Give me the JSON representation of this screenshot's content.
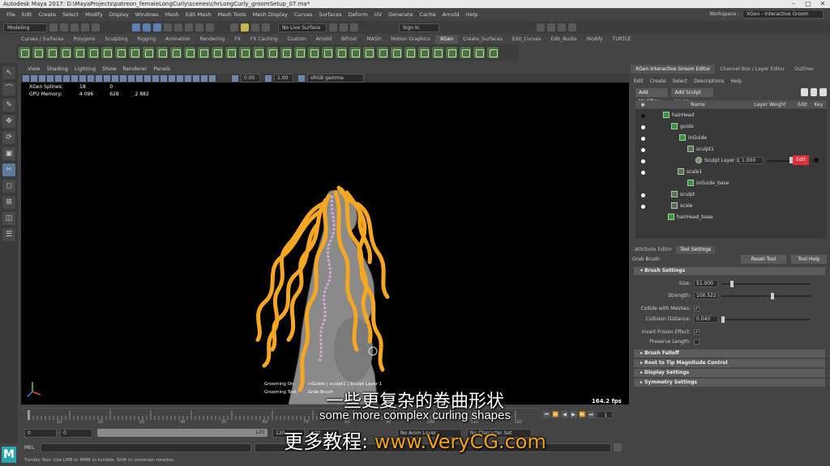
{
  "window": {
    "title": "Autodesk Maya 2017: D:\\MayaProjects\\patreon_femaleLongCurly\\scenes\\chrLongCurly_groomSetup_07.ma*",
    "controls": [
      "–",
      "□",
      "✕"
    ]
  },
  "menubar": {
    "items": [
      "File",
      "Edit",
      "Create",
      "Select",
      "Modify",
      "Display",
      "Windows",
      "Mesh",
      "Edit Mesh",
      "Mesh Tools",
      "Mesh Display",
      "Curves",
      "Surfaces",
      "Deform",
      "UV",
      "Generate",
      "Cache",
      "Arnold",
      "Help"
    ],
    "workspace_label": "Workspace :",
    "workspace_value": "XGen - Interactive Groom"
  },
  "statusline": {
    "mode": "Modeling",
    "live_surface": "No Live Surface",
    "sign_in": "Sign In"
  },
  "shelf": {
    "tabs": [
      "Curves / Surfaces",
      "Polygons",
      "Sculpting",
      "Rigging",
      "Animation",
      "Rendering",
      "FX",
      "FX Caching",
      "Custom",
      "Arnold",
      "Bifrost",
      "MASH",
      "Motion Graphics",
      "XGen",
      "Create_Surfaces",
      "Edit_Curves",
      "Edit_Nurbs",
      "Modify",
      "TURTLE"
    ],
    "active_tab": "XGen"
  },
  "viewport": {
    "menu": [
      "View",
      "Shading",
      "Lighting",
      "Show",
      "Renderer",
      "Panels"
    ],
    "exposure": "0.00",
    "gamma": "1.00",
    "color_space": "sRGB gamma",
    "hud": {
      "rows": [
        {
          "label": "XGen Splines:",
          "a": "18",
          "b": "0",
          "c": ""
        },
        {
          "label": "GPU Memory:",
          "a": "4 096",
          "b": "628",
          "c": "2 882"
        }
      ]
    },
    "groom_hud": {
      "on_label": "Grooming On:",
      "on_value": "inGuide | sculpt1 | Sculpt Layer 1",
      "tool_label": "Grooming Tool:",
      "tool_value": "Grab Brush"
    },
    "fps": "164.2 fps",
    "axis": {
      "y": "Y",
      "x": "X",
      "z": "Z"
    }
  },
  "timeline": {
    "numbers": [
      "10",
      "20",
      "30",
      "40",
      "50",
      "60",
      "70",
      "80",
      "90",
      "100",
      "110",
      "120"
    ],
    "current_frame": "1",
    "playback": [
      "⏮",
      "⏪",
      "◀",
      "▶",
      "⏩",
      "⏭"
    ]
  },
  "rangebar": {
    "start": "0",
    "playback_start": "0",
    "range_value": "120",
    "playback_end": "120",
    "end": "200",
    "anim_layer": "No Anim Layer",
    "char_set": "No Character Set"
  },
  "mel": {
    "label": "MEL"
  },
  "helpline": "Tumble Tool: Use LMB or MMB to tumble. Shift to constrain rotation.",
  "right_panel": {
    "tabs": [
      "XGen Interactive Groom Editor",
      "Channel Box / Layer Editor",
      "Outliner"
    ],
    "menu": [
      "Edit",
      "Create",
      "Select",
      "Descriptions",
      "Help"
    ],
    "add_modifier": "Add Modifier",
    "add_sculpt_layer": "Add Sculpt Layer",
    "columns": {
      "name": "Name",
      "layer_weight": "Layer Weight",
      "edit": "Edit",
      "key": "Key"
    },
    "tree": [
      {
        "label": "hairHead",
        "depth": 0
      },
      {
        "label": "guide",
        "depth": 1
      },
      {
        "label": "inGuide",
        "depth": 2
      },
      {
        "label": "sculpt1",
        "depth": 3
      },
      {
        "label": "Sculpt Layer 1",
        "depth": 4,
        "weight": "1.000"
      },
      {
        "label": "scale1",
        "depth": 3
      },
      {
        "label": "inGuide_base",
        "depth": 3
      },
      {
        "label": "sculpt",
        "depth": 1
      },
      {
        "label": "scale",
        "depth": 1
      },
      {
        "label": "hairHead_base",
        "depth": 1
      }
    ],
    "edit_button": "Edit"
  },
  "tool_settings": {
    "tabs": [
      "Attribute Editor",
      "Tool Settings"
    ],
    "active_tab": "Tool Settings",
    "tool_name": "Grab Brush",
    "reset_tool": "Reset Tool",
    "tool_help": "Tool Help",
    "brush_settings": "Brush Settings",
    "size_label": "Size:",
    "size_value": "51.000",
    "size_fraction": 0.1,
    "strength_label": "Strength:",
    "strength_value": "100.522",
    "strength_fraction": 0.55,
    "collide_label": "Collide with Meshes:",
    "collision_distance_label": "Collision Distance:",
    "collision_distance_value": "0.040",
    "invert_frozen_label": "Invert Frozen Effect:",
    "preserve_length_label": "Preserve Length:",
    "sections": [
      "Brush Falloff",
      "Root to Tip Magnitude Control",
      "Display Settings",
      "Symmetry Settings"
    ]
  },
  "subtitles": {
    "chinese": "一些更复杂的卷曲形状",
    "english": "some more complex curling shapes",
    "promo_prefix": "更多教程: ",
    "promo_site": "www.VeryCG.com"
  },
  "colors": {
    "hair": "#f5a623",
    "body": "#8c8c8c",
    "guide": "#d8a8d8",
    "accent_red": "#e0303a",
    "xgen_green": "#3f8f4a"
  }
}
